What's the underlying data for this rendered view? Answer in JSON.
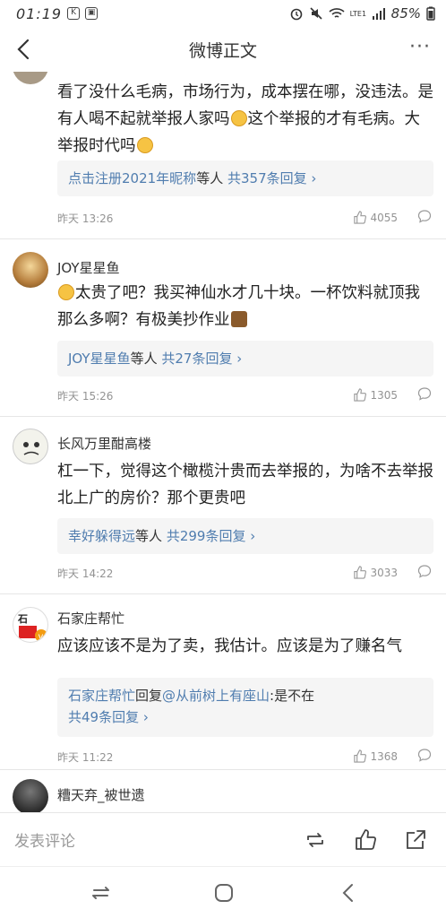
{
  "status_bar": {
    "time": "01:19",
    "battery": "85%",
    "network": "LTE1"
  },
  "nav": {
    "title": "微博正文",
    "more_label": "···"
  },
  "comments": [
    {
      "text_parts": [
        "看了没什么毛病，市场行为，成本摆在哪，没违法。是有人喝不起就举报人家吗",
        "这个举报的才有毛病。大举报时代吗"
      ],
      "reply_users": "点击注册2021年昵称",
      "reply_mid": "等人",
      "reply_count": "共357条回复",
      "time": "昨天 13:26",
      "likes": "4055"
    },
    {
      "username": "JOY星星鱼",
      "text": "太贵了吧？我买神仙水才几十块。一杯饮料就顶我那么多啊？有极美抄作业",
      "reply_users": "JOY星星鱼",
      "reply_mid": "等人",
      "reply_count": "共27条回复",
      "time": "昨天 15:26",
      "likes": "1305"
    },
    {
      "username": "长风万里酣高楼",
      "text": "杠一下，觉得这个橄榄汁贵而去举报的，为啥不去举报北上广的房价？那个更贵吧",
      "reply_users": "幸好躲得远",
      "reply_mid": "等人",
      "reply_count": "共299条回复",
      "time": "昨天 14:22",
      "likes": "3033"
    },
    {
      "username": "石家庄帮忙",
      "text": "应该应该不是为了卖，我估计。应该是为了赚名气",
      "reply_user": "石家庄帮忙",
      "reply_word": "回复",
      "reply_target": "@从前树上有座山",
      "reply_body": ":是不在",
      "reply_count": "共49条回复",
      "time": "昨天 11:22",
      "likes": "1368"
    },
    {
      "username": "糟天弃_被世遗"
    }
  ],
  "bottom_bar": {
    "input_placeholder": "发表评论"
  },
  "colors": {
    "link": "#507daf",
    "meta": "#939393",
    "divider": "#f2f2f2"
  }
}
